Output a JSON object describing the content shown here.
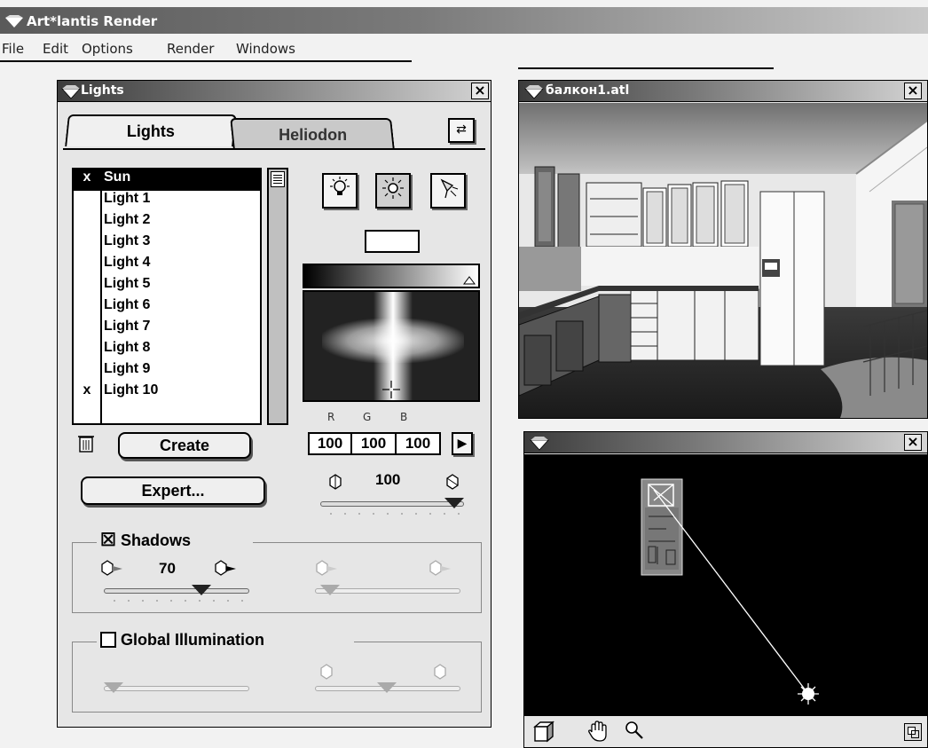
{
  "app": {
    "title": "Art*lantis Render",
    "menu": [
      "File",
      "Edit",
      "Options",
      "Render",
      "Windows"
    ]
  },
  "lights_window": {
    "title": "Lights",
    "tabs": [
      "Lights",
      "Heliodon"
    ],
    "active_tab": "Lights",
    "lights": [
      {
        "name": "Sun",
        "mark": "x",
        "selected": true
      },
      {
        "name": "Light 1",
        "mark": ""
      },
      {
        "name": "Light 2",
        "mark": ""
      },
      {
        "name": "Light 3",
        "mark": ""
      },
      {
        "name": "Light 4",
        "mark": ""
      },
      {
        "name": "Light 5",
        "mark": ""
      },
      {
        "name": "Light 6",
        "mark": ""
      },
      {
        "name": "Light 7",
        "mark": ""
      },
      {
        "name": "Light 8",
        "mark": ""
      },
      {
        "name": "Light 9",
        "mark": ""
      },
      {
        "name": "Light 10",
        "mark": "x"
      }
    ],
    "create_label": "Create",
    "expert_label": "Expert...",
    "rgb_labels": [
      "R",
      "G",
      "B"
    ],
    "rgb_values": [
      "100",
      "100",
      "100"
    ],
    "intensity": "100",
    "intensity_level": 1.0,
    "shadows": {
      "label": "Shadows",
      "checked": true,
      "check_mark": "☒",
      "value": "70",
      "level": 0.7
    },
    "global_illumination": {
      "label": "Global Illumination",
      "checked": false
    }
  },
  "view_window": {
    "title": "балкон1.atl"
  },
  "plan_window": {
    "title": ""
  },
  "icons": {
    "close": "close-icon",
    "trash": "trash-icon",
    "bulb": "bulb-icon",
    "sun": "sun-icon",
    "spot": "spot-icon",
    "hand": "hand-icon",
    "zoom": "zoom-icon",
    "cube": "cube-icon"
  }
}
